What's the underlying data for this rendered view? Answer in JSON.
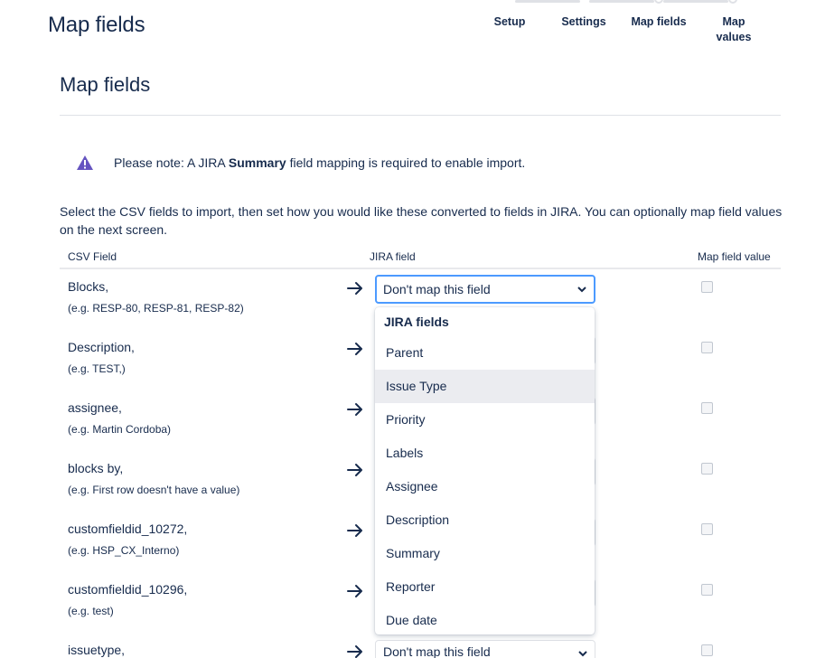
{
  "header": {
    "title": "Map fields"
  },
  "tracker": {
    "steps": [
      {
        "label": "Setup"
      },
      {
        "label": "Settings"
      },
      {
        "label": "Map fields"
      },
      {
        "label": "Map values"
      }
    ]
  },
  "section": {
    "title": "Map fields"
  },
  "note": {
    "prefix": "Please note: A JIRA ",
    "bold": "Summary",
    "suffix": " field mapping is required to enable import."
  },
  "intro": "Select the CSV fields to import, then set how you would like these converted to fields in JIRA. You can optionally map field values on the next screen.",
  "table": {
    "headers": {
      "csv": "CSV Field",
      "jira": "JIRA field",
      "map": "Map field value"
    },
    "rows": [
      {
        "name": "Blocks,",
        "example": "(e.g. RESP-80, RESP-81, RESP-82)",
        "select": "Don't map this field"
      },
      {
        "name": "Description,",
        "example": "(e.g. TEST,)",
        "select": ""
      },
      {
        "name": "assignee,",
        "example": "(e.g. Martin Cordoba)",
        "select": ""
      },
      {
        "name": "blocks by,",
        "example": "(e.g. First row doesn't have a value)",
        "select": ""
      },
      {
        "name": "customfieldid_10272,",
        "example": "(e.g. HSP_CX_Interno)",
        "select": ""
      },
      {
        "name": "customfieldid_10296,",
        "example": "(e.g. test)",
        "select": ""
      },
      {
        "name": "issuetype,",
        "example": "",
        "select": "Don't map this field"
      }
    ]
  },
  "dropdown": {
    "group": "JIRA fields",
    "items": [
      "Parent",
      "Issue Type",
      "Priority",
      "Labels",
      "Assignee",
      "Description",
      "Summary",
      "Reporter",
      "Due date"
    ],
    "hovered": "Issue Type"
  },
  "colors": {
    "accent": "#4c9aff",
    "warning": "#6554c0",
    "text": "#172b4d"
  }
}
